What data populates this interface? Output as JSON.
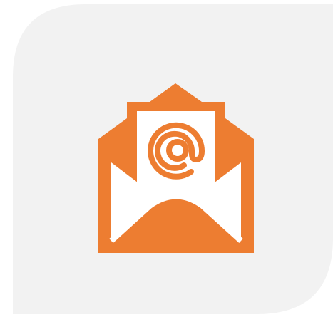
{
  "icon": {
    "name": "open-envelope-email-icon",
    "symbol": "@",
    "accent_color": "#ED7D31",
    "card_color": "#F2F2F2",
    "paper_color": "#FFFFFF"
  }
}
